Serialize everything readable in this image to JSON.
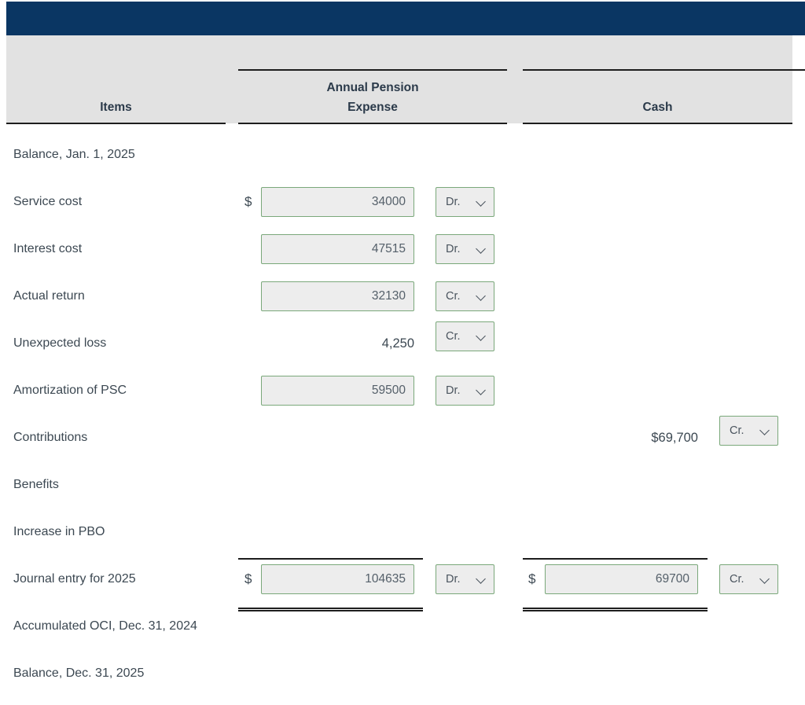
{
  "window": {
    "accent_navy": "#0a3663",
    "header_bg": "#e2e2e2",
    "input_border": "#7aa87a",
    "input_bg": "#ededed",
    "text_color": "#3c4852"
  },
  "table": {
    "headers": {
      "items": "Items",
      "annual_pension_expense_line1": "Annual Pension",
      "annual_pension_expense_line2": "Expense",
      "cash": "Cash"
    },
    "rows": [
      {
        "label": "Balance, Jan. 1, 2025",
        "expense": {
          "kind": "empty"
        },
        "cash": {
          "kind": "empty"
        }
      },
      {
        "label": "Service cost",
        "expense": {
          "kind": "input",
          "dollar": "$",
          "value": "34000",
          "drcr": "Dr.",
          "drcr_options": [
            "Dr.",
            "Cr."
          ]
        },
        "cash": {
          "kind": "empty"
        }
      },
      {
        "label": "Interest cost",
        "expense": {
          "kind": "input",
          "dollar": "",
          "value": "47515",
          "drcr": "Dr.",
          "drcr_options": [
            "Dr.",
            "Cr."
          ]
        },
        "cash": {
          "kind": "empty"
        }
      },
      {
        "label": "Actual return",
        "expense": {
          "kind": "input",
          "dollar": "",
          "value": "32130",
          "drcr": "Cr.",
          "drcr_options": [
            "Dr.",
            "Cr."
          ]
        },
        "cash": {
          "kind": "empty"
        }
      },
      {
        "label": "Unexpected loss",
        "expense": {
          "kind": "text",
          "dollar": "",
          "value": "4,250",
          "drcr": "Cr.",
          "drcr_options": [
            "Dr.",
            "Cr."
          ]
        },
        "cash": {
          "kind": "empty"
        }
      },
      {
        "label": "Amortization of PSC",
        "expense": {
          "kind": "input",
          "dollar": "",
          "value": "59500",
          "drcr": "Dr.",
          "drcr_options": [
            "Dr.",
            "Cr."
          ]
        },
        "cash": {
          "kind": "empty"
        }
      },
      {
        "label": "Contributions",
        "expense": {
          "kind": "empty"
        },
        "cash": {
          "kind": "text",
          "dollar": "",
          "value": "$69,700",
          "drcr": "Cr.",
          "drcr_options": [
            "Dr.",
            "Cr."
          ]
        }
      },
      {
        "label": "Benefits",
        "expense": {
          "kind": "empty"
        },
        "cash": {
          "kind": "empty"
        }
      },
      {
        "label": "Increase in PBO",
        "expense": {
          "kind": "empty"
        },
        "cash": {
          "kind": "empty"
        }
      },
      {
        "label": "Journal entry for 2025",
        "total": true,
        "expense": {
          "kind": "input",
          "dollar": "$",
          "value": "104635",
          "drcr": "Dr.",
          "drcr_options": [
            "Dr.",
            "Cr."
          ]
        },
        "cash": {
          "kind": "input",
          "dollar": "$",
          "value": "69700",
          "drcr": "Cr.",
          "drcr_options": [
            "Dr.",
            "Cr."
          ]
        }
      },
      {
        "label": "Accumulated OCI, Dec. 31, 2024",
        "expense": {
          "kind": "empty"
        },
        "cash": {
          "kind": "empty"
        }
      },
      {
        "label": "Balance, Dec. 31, 2025",
        "expense": {
          "kind": "empty"
        },
        "cash": {
          "kind": "empty"
        }
      }
    ]
  }
}
